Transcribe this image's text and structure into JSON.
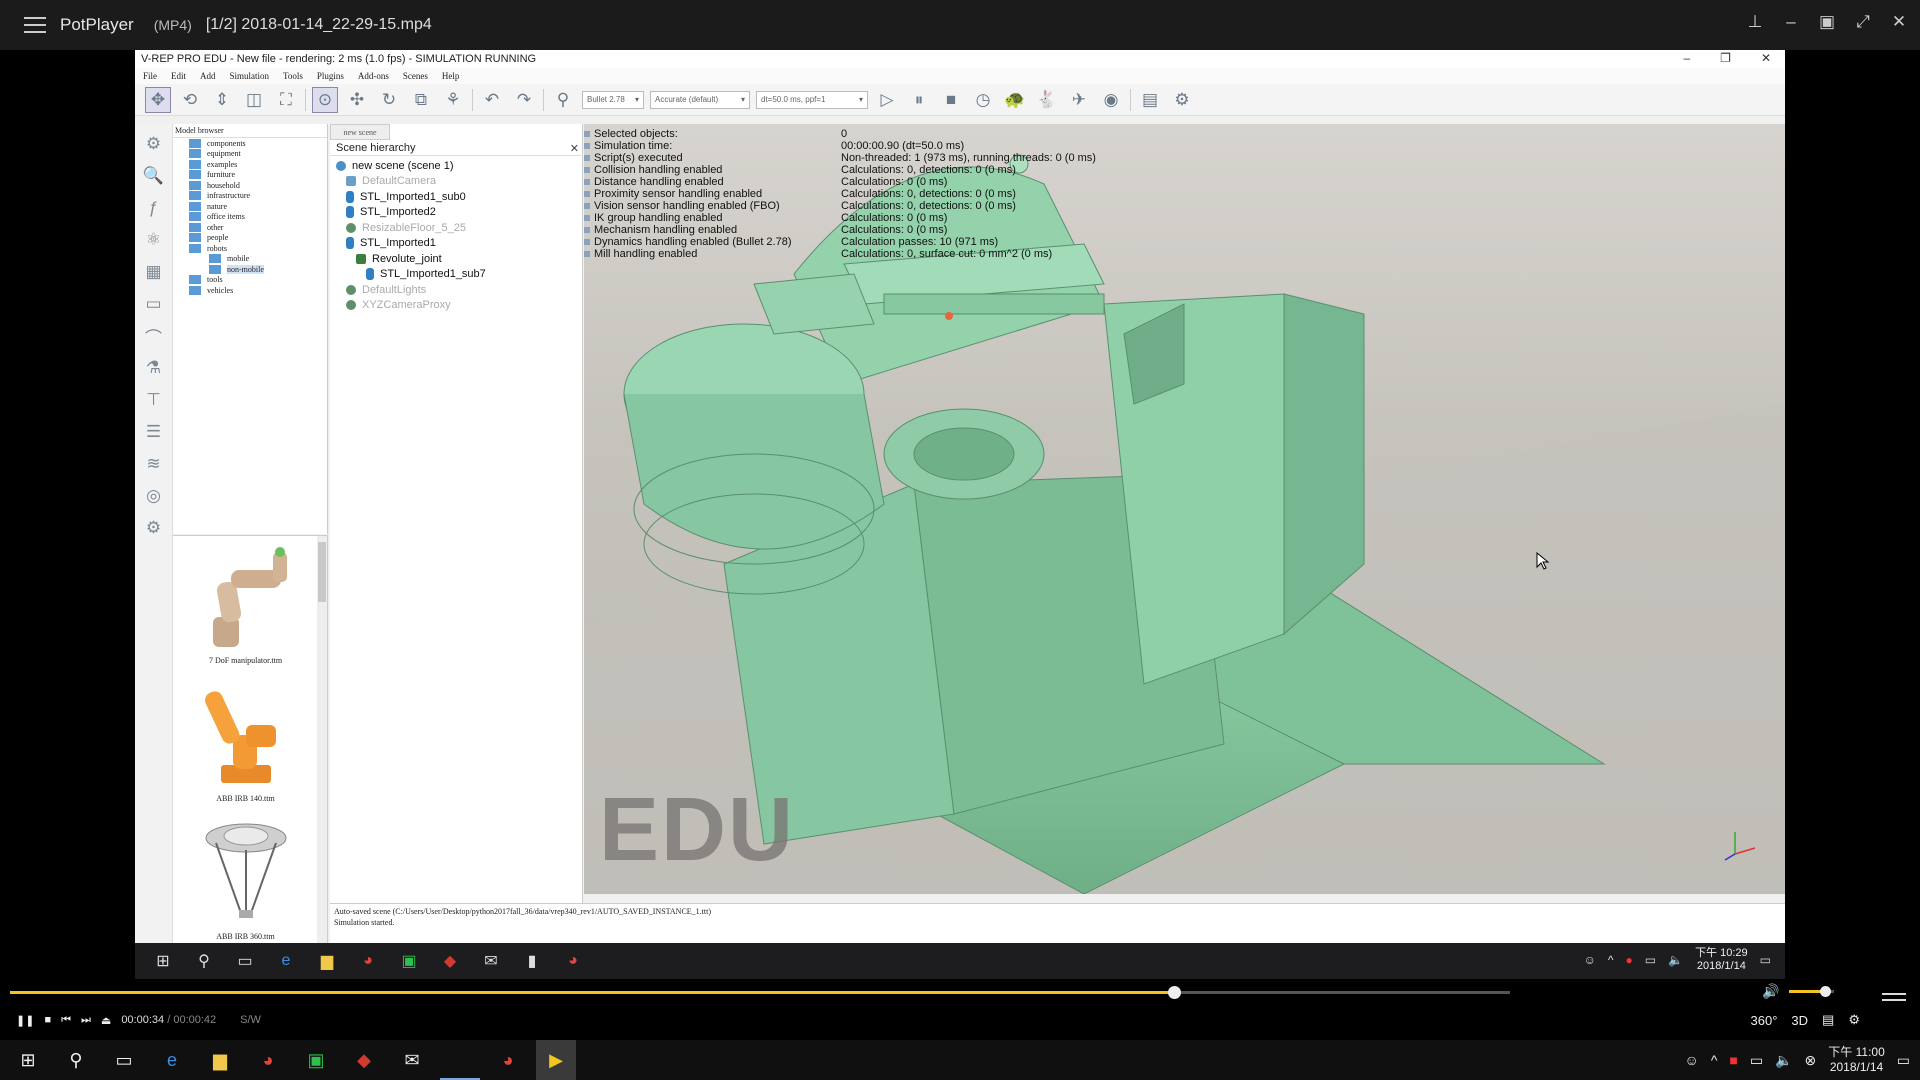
{
  "player": {
    "app_name": "PotPlayer",
    "format": "(MP4)",
    "file": "[1/2] 2018-01-14_22-29-15.mp4",
    "time_current": "00:00:34",
    "time_sep": "/",
    "time_total": "00:00:42",
    "sw_label": "S/W",
    "progress": 0.776,
    "volume": 0.78,
    "right_buttons": [
      "360°",
      "3D"
    ]
  },
  "vrep": {
    "title": "V-REP PRO EDU - New file - rendering: 2 ms (1.0 fps) - SIMULATION RUNNING",
    "menu": [
      "File",
      "Edit",
      "Add",
      "Simulation",
      "Tools",
      "Plugins",
      "Add-ons",
      "Scenes",
      "Help"
    ],
    "engine_select": "Bullet 2.78",
    "accuracy_select": "Accurate (default)",
    "dt_select": "dt=50.0 ms, ppf=1",
    "model_browser_title": "Model browser",
    "model_folders": [
      "components",
      "equipment",
      "examples",
      "furniture",
      "household",
      "infrastructure",
      "nature",
      "office items",
      "other",
      "people",
      "robots",
      "mobile",
      "non-mobile",
      "tools",
      "vehicles"
    ],
    "models": [
      {
        "label": "7 DoF manipulator.ttm"
      },
      {
        "label": "ABB IRB 140.ttm"
      },
      {
        "label": "ABB IRB 360.ttm"
      }
    ],
    "scene_tab": "new scene",
    "scene_hierarchy_title": "Scene hierarchy",
    "scene_items": [
      {
        "label": "new scene (scene 1)",
        "level": 0,
        "kind": "root",
        "dim": false
      },
      {
        "label": "DefaultCamera",
        "level": 1,
        "kind": "cam",
        "dim": true
      },
      {
        "label": "STL_Imported1_sub0",
        "level": 1,
        "kind": "obj",
        "dim": false
      },
      {
        "label": "STL_Imported2",
        "level": 1,
        "kind": "obj",
        "dim": false
      },
      {
        "label": "ResizableFloor_5_25",
        "level": 1,
        "kind": "env",
        "dim": true
      },
      {
        "label": "STL_Imported1",
        "level": 1,
        "kind": "obj",
        "dim": false
      },
      {
        "label": "Revolute_joint",
        "level": 2,
        "kind": "joint",
        "dim": false
      },
      {
        "label": "STL_Imported1_sub7",
        "level": 3,
        "kind": "obj",
        "dim": false
      },
      {
        "label": "DefaultLights",
        "level": 1,
        "kind": "env",
        "dim": true
      },
      {
        "label": "XYZCameraProxy",
        "level": 1,
        "kind": "env",
        "dim": true
      }
    ],
    "info_labels": [
      "Selected objects:",
      "Simulation time:",
      "Script(s) executed",
      "Collision handling enabled",
      "Distance handling enabled",
      "Proximity sensor handling enabled",
      "Vision sensor handling enabled (FBO)",
      "IK group handling enabled",
      "Mechanism handling enabled",
      "Dynamics handling enabled (Bullet 2.78)",
      "Mill handling enabled"
    ],
    "info_values": [
      "0",
      "00:00:00.90 (dt=50.0 ms)",
      "Non-threaded: 1 (973 ms), running threads: 0 (0 ms)",
      "Calculations: 0, detections: 0 (0 ms)",
      "Calculations: 0 (0 ms)",
      "Calculations: 0, detections: 0 (0 ms)",
      "Calculations: 0, detections: 0 (0 ms)",
      "Calculations: 0 (0 ms)",
      "Calculations: 0 (0 ms)",
      "Calculation passes: 10 (971 ms)",
      "Calculations: 0, surface cut: 0 mm^2 (0 ms)"
    ],
    "watermark": "EDU",
    "status_lines": [
      "Auto-saved scene (C:/Users/User/Desktop/python2017fall_36/data/vrep340_rev1/AUTO_SAVED_INSTANCE_1.ttt)",
      "Simulation started."
    ]
  },
  "inner_taskbar": {
    "time": "下午 10:29",
    "date": "2018/1/14"
  },
  "taskbar": {
    "time": "下午 11:00",
    "date": "2018/1/14"
  },
  "colors": {
    "accent": "#f3c521",
    "model_green": "#8fcaa6"
  }
}
